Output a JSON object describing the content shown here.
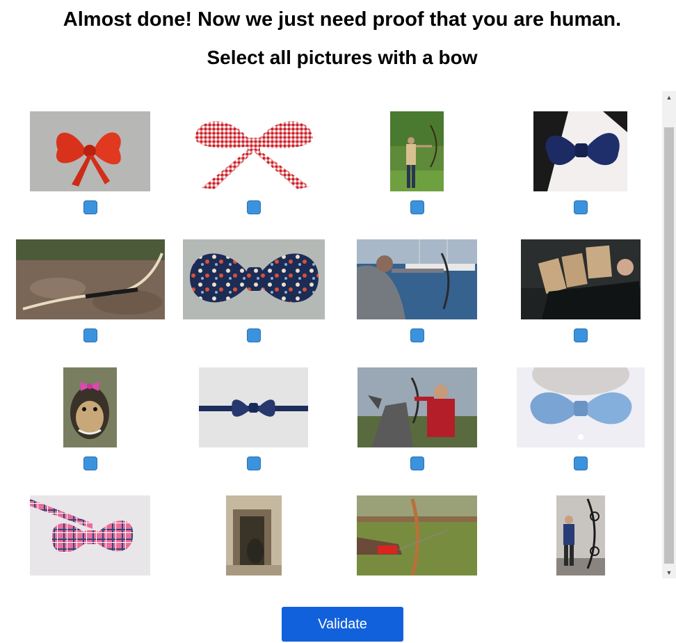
{
  "header": {
    "title": "Almost done! Now we just need proof that you are human.",
    "subtitle": "Select all pictures with a bow"
  },
  "tiles": [
    {
      "name": "red-ribbon-bow",
      "checked": false
    },
    {
      "name": "gingham-ribbon-bow",
      "checked": false
    },
    {
      "name": "archer-field",
      "checked": false
    },
    {
      "name": "navy-bowtie-collar",
      "checked": false
    },
    {
      "name": "wooden-bow-on-ground",
      "checked": false
    },
    {
      "name": "floral-bowtie",
      "checked": false
    },
    {
      "name": "archer-marina",
      "checked": false
    },
    {
      "name": "dervish-hats",
      "checked": false
    },
    {
      "name": "yorkie-pink-bow",
      "checked": false
    },
    {
      "name": "navy-bowtie-strap",
      "checked": false
    },
    {
      "name": "horseback-archer",
      "checked": false
    },
    {
      "name": "light-blue-bowtie",
      "checked": false
    },
    {
      "name": "plaid-pink-bowtie",
      "checked": false
    },
    {
      "name": "vintage-doorway",
      "checked": false
    },
    {
      "name": "archery-range-arm",
      "checked": false
    },
    {
      "name": "compound-bow-archer",
      "checked": false
    }
  ],
  "actions": {
    "validate_label": "Validate"
  },
  "colors": {
    "checkbox": "#3b93dd",
    "validate_button": "#1261dc"
  }
}
